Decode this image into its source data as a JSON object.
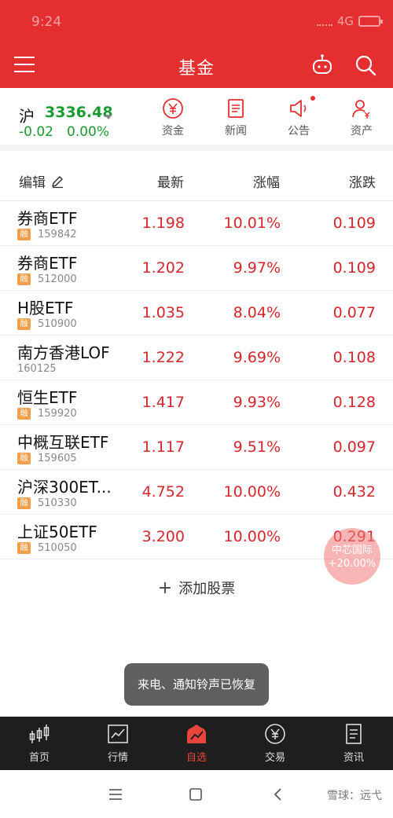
{
  "status_bar": {
    "time": "9:24",
    "network": "4G"
  },
  "header": {
    "title": "基金",
    "menu_icon": "hamburger-icon",
    "robot_icon": "robot-icon",
    "search_icon": "search-icon"
  },
  "index": {
    "name": "沪",
    "value": "3336.48",
    "change": "-0.02",
    "percent": "0.00%",
    "color": "#1a9b2f"
  },
  "quick_links": [
    {
      "label": "资金",
      "icon": "yuan-circle-icon"
    },
    {
      "label": "新闻",
      "icon": "news-icon"
    },
    {
      "label": "公告",
      "icon": "megaphone-icon",
      "badge_dot": true
    },
    {
      "label": "资产",
      "icon": "user-yen-icon"
    }
  ],
  "columns": {
    "edit": "编辑",
    "latest": "最新",
    "change_pct": "涨幅",
    "change": "涨跌"
  },
  "funds": [
    {
      "name": "券商ETF",
      "badge": "融",
      "code": "159842",
      "price": "1.198",
      "pct": "10.01%",
      "chg": "0.109"
    },
    {
      "name": "券商ETF",
      "badge": "融",
      "code": "512000",
      "price": "1.202",
      "pct": "9.97%",
      "chg": "0.109"
    },
    {
      "name": "H股ETF",
      "badge": "融",
      "code": "510900",
      "price": "1.035",
      "pct": "8.04%",
      "chg": "0.077"
    },
    {
      "name": "南方香港LOF",
      "badge": "",
      "code": "160125",
      "price": "1.222",
      "pct": "9.69%",
      "chg": "0.108"
    },
    {
      "name": "恒生ETF",
      "badge": "融",
      "code": "159920",
      "price": "1.417",
      "pct": "9.93%",
      "chg": "0.128"
    },
    {
      "name": "中概互联ETF",
      "badge": "融",
      "code": "159605",
      "price": "1.117",
      "pct": "9.51%",
      "chg": "0.097"
    },
    {
      "name": "沪深300ET...",
      "badge": "融",
      "code": "510330",
      "price": "4.752",
      "pct": "10.00%",
      "chg": "0.432"
    },
    {
      "name": "上证50ETF",
      "badge": "融",
      "code": "510050",
      "price": "3.200",
      "pct": "10.00%",
      "chg": "0.291"
    }
  ],
  "add_stock": {
    "plus": "+",
    "label": "添加股票"
  },
  "floating": {
    "name": "中芯国际",
    "pct": "+20.00%"
  },
  "toast": "来电、通知铃声已恢复",
  "tabs": [
    {
      "label": "首页",
      "icon": "candlestick-icon"
    },
    {
      "label": "行情",
      "icon": "line-chart-icon"
    },
    {
      "label": "自选",
      "icon": "favorites-icon",
      "active": true
    },
    {
      "label": "交易",
      "icon": "yuan-circle-icon"
    },
    {
      "label": "资讯",
      "icon": "document-icon"
    }
  ],
  "system_nav": {
    "menu_icon": "menu-lines-icon",
    "home_icon": "square-home-icon",
    "back_icon": "back-chevron-icon"
  },
  "watermark": "雪球：远弋",
  "colors": {
    "brand_red": "#e52e30",
    "up_red": "#d5262c",
    "down_green": "#1a9b2f",
    "badge_orange": "#f0a04b"
  }
}
